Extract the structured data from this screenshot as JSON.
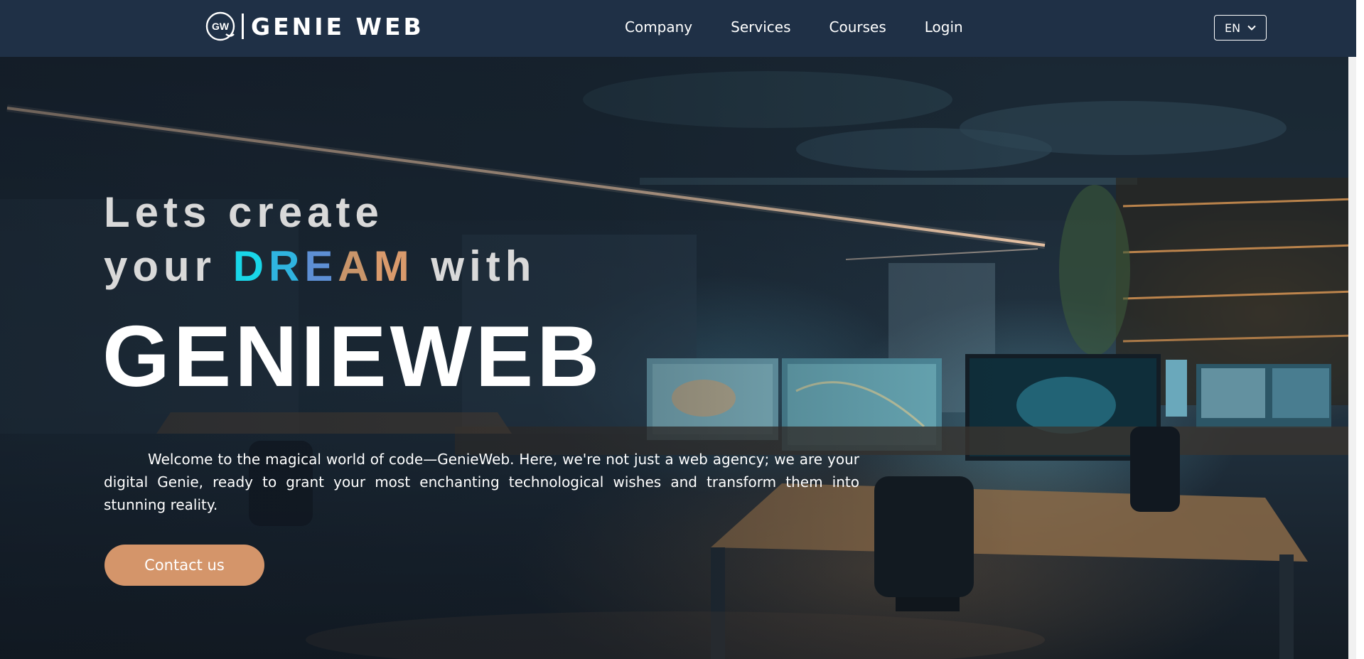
{
  "header": {
    "brand": "GENIE WEB",
    "logo_initials": "GW",
    "nav": [
      {
        "label": "Company"
      },
      {
        "label": "Services"
      },
      {
        "label": "Courses"
      },
      {
        "label": "Login"
      }
    ],
    "language": {
      "selected": "EN",
      "icon": "chevron-down-icon"
    }
  },
  "hero": {
    "headline_line1": "Lets create",
    "headline_line2_pre": "your",
    "headline_highlight": [
      "D",
      "R",
      "E",
      "A",
      "M"
    ],
    "headline_highlight_colors": [
      "#19d6e8",
      "#2fb4e0",
      "#5d8fd4",
      "#c9956a",
      "#d99a6c"
    ],
    "headline_line2_post": "with",
    "brand_big": "GENIEWEB",
    "intro": "Welcome to the magical world of code—GenieWeb. Here, we're not just a web agency; we are your digital Genie, ready to grant your most enchanting technological wishes and transform them into stunning reality.",
    "cta_label": "Contact us"
  },
  "colors": {
    "header_bg": "#1f3046",
    "accent": "#d4956a",
    "text": "#ffffff"
  }
}
